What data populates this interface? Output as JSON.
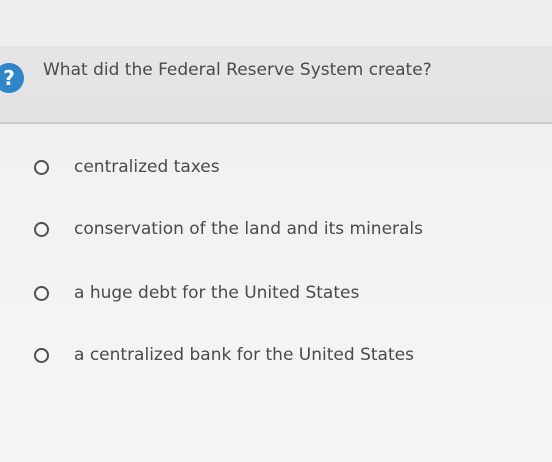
{
  "question": {
    "icon": "question-mark-icon",
    "icon_glyph": "?",
    "text": "What did the Federal Reserve System create?"
  },
  "options": [
    {
      "label": "centralized taxes"
    },
    {
      "label": "conservation of the land and its minerals"
    },
    {
      "label": "a huge debt for the United States"
    },
    {
      "label": "a centralized bank for the United States"
    }
  ],
  "colors": {
    "badge": "#2e85c8",
    "text": "#4a4a4a",
    "question_bar": "#e4e4e4",
    "background": "#f3f3f3"
  }
}
